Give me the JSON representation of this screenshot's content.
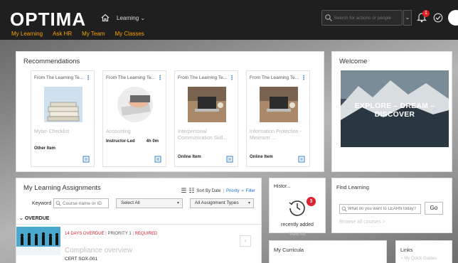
{
  "header": {
    "brand": "OPTIMA",
    "menu_label": "Learning",
    "search_placeholder": "Search for actions or people",
    "notification_count": "1"
  },
  "subnav": [
    "My Learning",
    "Ask HR",
    "My Team",
    "My Classes"
  ],
  "recommendations": {
    "title": "Recommendations",
    "cards": [
      {
        "source": "From The Learning Te...",
        "title": "Mylan Checklist",
        "type": "Other Item",
        "duration": ""
      },
      {
        "source": "From The Learning Te...",
        "title": "Accounting",
        "type": "Instructor-Led",
        "duration": "4h 0m"
      },
      {
        "source": "From The Learning Te...",
        "title": "Interpersonal Communication Skill...",
        "type": "Online Item",
        "duration": ""
      },
      {
        "source": "From The Learning Te...",
        "title": "Information Protection - Minimum ...",
        "type": "Online Item",
        "duration": ""
      }
    ]
  },
  "welcome": {
    "title": "Welcome",
    "banner_text": "EXPLORE – DREAM – DISCOVER"
  },
  "assignments": {
    "title": "My Learning Assignments",
    "sort_label": "Sort By Date",
    "priority_link": "Priority",
    "filter_link": "Filter",
    "keyword_label": "Keyword",
    "keyword_placeholder": "Course name or ID",
    "select_all": "Select All",
    "type_select": "All Assignment Types",
    "overdue_label": "OVERDUE",
    "item": {
      "days_overdue": "14 DAYS OVERDUE",
      "priority": "PRIORITY 1",
      "required": "REQUIRED",
      "title": "Compliance overview",
      "cert": "CERT SOX-001"
    }
  },
  "history": {
    "title": "Histor...",
    "badge": "3",
    "label": "recently added",
    "view_all": "View All"
  },
  "find_learning": {
    "title": "Find Learning",
    "placeholder": "What do you want to LEARN today?",
    "go": "Go",
    "browse": "Browse all courses >"
  },
  "curricula": {
    "title": "My Curricula"
  },
  "links": {
    "title": "Links",
    "first": "My Quick Guides"
  },
  "colors": {
    "accent_orange": "#f5a000",
    "link_blue": "#1a73c8",
    "badge_red": "#e02030",
    "nav_bg": "#1f1f1f"
  }
}
